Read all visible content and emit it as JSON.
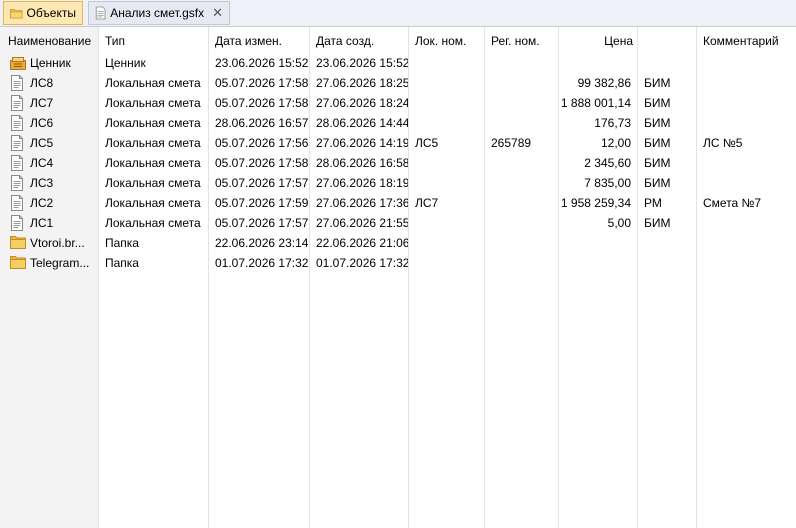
{
  "tabs": [
    {
      "label": "Объекты",
      "icon": "folder-icon",
      "active": true
    },
    {
      "label": "Анализ смет.gsfx",
      "icon": "document-icon",
      "active": false,
      "close_glyph": "✕"
    }
  ],
  "columns": {
    "name": "Наименование",
    "type": "Тип",
    "modified": "Дата измен.",
    "created": "Дата созд.",
    "loc_num": "Лок. ном.",
    "reg_num": "Рег. ном.",
    "price": "Цена",
    "unit": "",
    "comment": "Комментарий"
  },
  "rows": [
    {
      "name": "Ценник",
      "icon": "price-list-icon",
      "type": "Ценник",
      "modified": "23.06.2026 15:52",
      "created": "23.06.2026 15:52",
      "loc_num": "",
      "reg_num": "",
      "price": "",
      "unit": "",
      "comment": ""
    },
    {
      "name": "ЛС8",
      "icon": "document-icon",
      "type": "Локальная смета",
      "modified": "05.07.2026 17:58",
      "created": "27.06.2026 18:25",
      "loc_num": "",
      "reg_num": "",
      "price": "99 382,86",
      "unit": "БИМ",
      "comment": ""
    },
    {
      "name": "ЛС7",
      "icon": "document-icon",
      "type": "Локальная смета",
      "modified": "05.07.2026 17:58",
      "created": "27.06.2026 18:24",
      "loc_num": "",
      "reg_num": "",
      "price": "1 888 001,14",
      "unit": "БИМ",
      "comment": ""
    },
    {
      "name": "ЛС6",
      "icon": "document-icon",
      "type": "Локальная смета",
      "modified": "28.06.2026 16:57",
      "created": "28.06.2026 14:44",
      "loc_num": "",
      "reg_num": "",
      "price": "176,73",
      "unit": "БИМ",
      "comment": ""
    },
    {
      "name": "ЛС5",
      "icon": "document-icon",
      "type": "Локальная смета",
      "modified": "05.07.2026 17:56",
      "created": "27.06.2026 14:19",
      "loc_num": "ЛС5",
      "reg_num": "265789",
      "price": "12,00",
      "unit": "БИМ",
      "comment": "ЛС №5"
    },
    {
      "name": "ЛС4",
      "icon": "document-icon",
      "type": "Локальная смета",
      "modified": "05.07.2026 17:58",
      "created": "28.06.2026 16:58",
      "loc_num": "",
      "reg_num": "",
      "price": "2 345,60",
      "unit": "БИМ",
      "comment": ""
    },
    {
      "name": "ЛС3",
      "icon": "document-icon",
      "type": "Локальная смета",
      "modified": "05.07.2026 17:57",
      "created": "27.06.2026 18:19",
      "loc_num": "",
      "reg_num": "",
      "price": "7 835,00",
      "unit": "БИМ",
      "comment": ""
    },
    {
      "name": "ЛС2",
      "icon": "document-icon",
      "type": "Локальная смета",
      "modified": "05.07.2026 17:59",
      "created": "27.06.2026 17:36",
      "loc_num": "ЛС7",
      "reg_num": "",
      "price": "1 958 259,34",
      "unit": "РМ",
      "comment": "Смета №7"
    },
    {
      "name": "ЛС1",
      "icon": "document-icon",
      "type": "Локальная смета",
      "modified": "05.07.2026 17:57",
      "created": "27.06.2026 21:55",
      "loc_num": "",
      "reg_num": "",
      "price": "5,00",
      "unit": "БИМ",
      "comment": ""
    },
    {
      "name": "Vtoroi.br...",
      "icon": "folder-icon",
      "type": "Папка",
      "modified": "22.06.2026 23:14",
      "created": "22.06.2026 21:06",
      "loc_num": "",
      "reg_num": "",
      "price": "",
      "unit": "",
      "comment": ""
    },
    {
      "name": "Telegram...",
      "icon": "folder-icon",
      "type": "Папка",
      "modified": "01.07.2026 17:32",
      "created": "01.07.2026 17:32",
      "loc_num": "",
      "reg_num": "",
      "price": "",
      "unit": "",
      "comment": ""
    }
  ],
  "colors": {
    "tab_active": "#fde7b2",
    "name_column_bg": "#f3f3f3",
    "grid_line": "#e3e3e3"
  }
}
